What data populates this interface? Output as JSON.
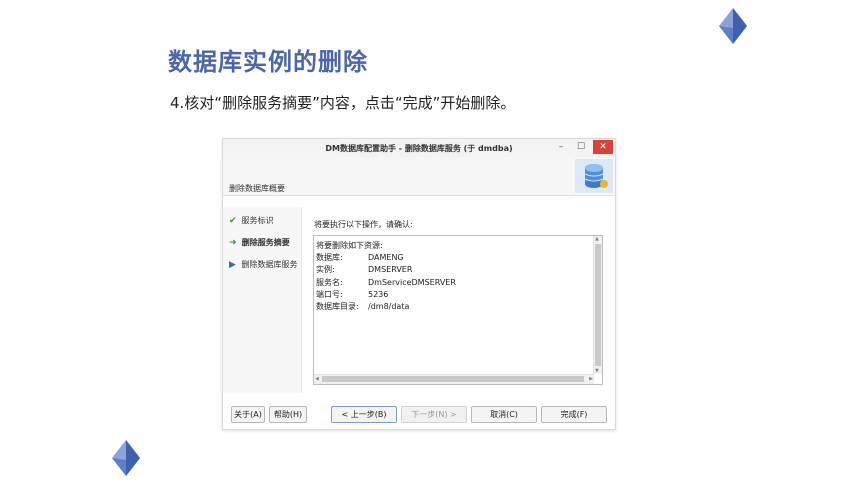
{
  "slide": {
    "title": "数据库实例的删除",
    "subtitle": "4.核对“删除服务摘要”内容，点击“完成”开始删除。"
  },
  "dialog": {
    "window_title": "DM数据库配置助手 - 删除数据库服务 (于 dmdba)",
    "window_controls": {
      "minimize": "–",
      "maximize": "☐",
      "close": "✕"
    },
    "header_label": "删除数据库概要",
    "nav": [
      {
        "label": "服务标识",
        "state": "done",
        "icon": "check-icon"
      },
      {
        "label": "删除服务摘要",
        "state": "current",
        "icon": "arrow-right-icon"
      },
      {
        "label": "删除数据库服务",
        "state": "next",
        "icon": "triangle-right-icon"
      }
    ],
    "content_label": "将要执行以下操作，请确认:",
    "summary": {
      "heading": "将要删除如下资源:",
      "rows": [
        {
          "key": "数据库:",
          "value": "DAMENG"
        },
        {
          "key": "实例:",
          "value": "DMSERVER"
        },
        {
          "key": "服务名:",
          "value": "DmServiceDMSERVER"
        },
        {
          "key": "端口号:",
          "value": "5236"
        },
        {
          "key": "数据库目录:",
          "value": "/dm8/data"
        }
      ]
    },
    "buttons": {
      "about": "关于(A)",
      "help": "帮助(H)",
      "prev": "< 上一步(B)",
      "next": "下一步(N) >",
      "cancel": "取消(C)",
      "finish": "完成(F)"
    }
  },
  "colors": {
    "title": "#4a66ad",
    "diamond_light": "#8aa3dc",
    "diamond_dark": "#3f5fb0",
    "close_button": "#d9413a"
  }
}
